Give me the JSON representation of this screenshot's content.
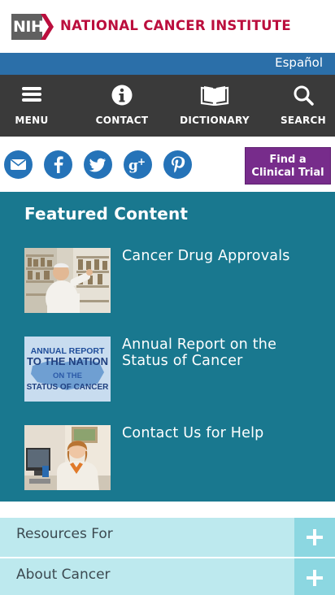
{
  "header": {
    "nih_text": "NIH",
    "institute_title": "NATIONAL CANCER INSTITUTE"
  },
  "language_link": "Español",
  "nav": [
    {
      "label": "MENU",
      "icon": "hamburger-icon"
    },
    {
      "label": "CONTACT",
      "icon": "info-icon"
    },
    {
      "label": "DICTIONARY",
      "icon": "book-icon"
    },
    {
      "label": "SEARCH",
      "icon": "search-icon"
    }
  ],
  "social": [
    {
      "icon": "email-icon",
      "glyph": "✉"
    },
    {
      "icon": "facebook-icon",
      "glyph": "f"
    },
    {
      "icon": "twitter-icon",
      "glyph": ""
    },
    {
      "icon": "google-plus-icon",
      "glyph": "g+"
    },
    {
      "icon": "pinterest-icon",
      "glyph": "P"
    }
  ],
  "trial_button": {
    "line1": "Find a",
    "line2": "Clinical Trial"
  },
  "featured": {
    "title": "Featured Content",
    "items": [
      {
        "label": "Cancer Drug Approvals"
      },
      {
        "label": "Annual Report on the Status of Cancer",
        "thumb_text": [
          "ANNUAL REPORT",
          "TO THE NATION",
          "ON THE",
          "STATUS OF CANCER"
        ]
      },
      {
        "label": "Contact Us for Help"
      }
    ]
  },
  "accordions": [
    {
      "label": "Resources For"
    },
    {
      "label": "About Cancer"
    }
  ],
  "colors": {
    "brand_red": "#bb0e3d",
    "lang_bar": "#2b6fa9",
    "nav_bg": "#3a3a3a",
    "social_blue": "#2573b8",
    "trial_purple": "#772c8b",
    "featured_teal": "#19788f",
    "accordion_bg": "#bde9ee",
    "accordion_plus": "#8cd7e1"
  }
}
